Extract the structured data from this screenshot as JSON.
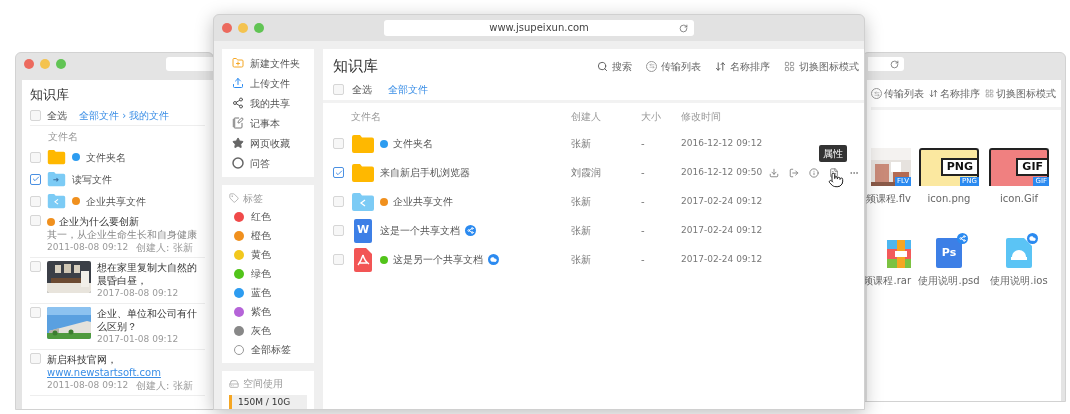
{
  "left_window": {
    "title": "知识库",
    "select_all": {
      "label": "全选",
      "checked": false
    },
    "breadcrumb": "全部文件 › 我的文件",
    "column_header": "文件名",
    "files": [
      {
        "kind": "folder",
        "name": "文件夹名",
        "color": "#2d9cf0",
        "checked": false
      },
      {
        "kind": "upload-folder",
        "name": "读写文件",
        "checked": true
      },
      {
        "kind": "share-folder",
        "name": "企业共享文件",
        "color": "#f0901e",
        "checked": false
      }
    ],
    "articles": [
      {
        "kind": "text",
        "title": "企业为什么要创新",
        "color": "#f0901e",
        "snippet": "其一，从企业生命生长和自身健康",
        "date": "2011-08-08 09:12",
        "creator": "创建人: 张新",
        "checked": false
      },
      {
        "kind": "room-picture",
        "title": "想在家里复制大自然的晨昏白昼，",
        "date": "2017-08-08 09:12",
        "checked": false
      },
      {
        "kind": "building-picture",
        "title": "企业、单位和公司有什么区别？",
        "date": "2017-01-08 09:12",
        "checked": false
      },
      {
        "kind": "link",
        "title": "新启科技官网，",
        "link": "www.newstartsoft.com",
        "date": "2011-08-08 09:12",
        "creator": "创建人: 张新",
        "checked": false
      }
    ]
  },
  "main_window": {
    "url": "www.jsupeixun.com",
    "menu": [
      {
        "kind": "new-folder",
        "label": "新建文件夹"
      },
      {
        "kind": "upload",
        "label": "上传文件"
      },
      {
        "kind": "share",
        "label": "我的共享"
      },
      {
        "kind": "notebook",
        "label": "记事本"
      },
      {
        "kind": "star",
        "label": "网页收藏"
      },
      {
        "kind": "qa",
        "label": "问答"
      }
    ],
    "tags_title": "标签",
    "tags": [
      {
        "kind": "color",
        "label": "红色",
        "color": "#f04a4a"
      },
      {
        "kind": "color",
        "label": "橙色",
        "color": "#f0901e"
      },
      {
        "kind": "color",
        "label": "黄色",
        "color": "#f2c81e"
      },
      {
        "kind": "color",
        "label": "绿色",
        "color": "#52c41a"
      },
      {
        "kind": "color",
        "label": "蓝色",
        "color": "#2d9cf0"
      },
      {
        "kind": "color",
        "label": "紫色",
        "color": "#b564d8"
      },
      {
        "kind": "color",
        "label": "灰色",
        "color": "#888888"
      },
      {
        "kind": "all",
        "label": "全部标签"
      }
    ],
    "storage": {
      "title": "空间使用",
      "reading": "150M / 10G",
      "level": 0.04
    },
    "title": "知识库",
    "toolbar": [
      {
        "kind": "search",
        "label": "搜索"
      },
      {
        "kind": "transfer",
        "label": "传输列表"
      },
      {
        "kind": "sort",
        "label": "名称排序"
      },
      {
        "kind": "view",
        "label": "切换图标模式"
      }
    ],
    "select_all": {
      "label": "全选",
      "checked": false
    },
    "breadcrumb": "全部文件",
    "columns": [
      "文件名",
      "创建人",
      "大小",
      "修改时间"
    ],
    "rows": [
      {
        "kind": "folder",
        "name": "文件夹名",
        "color": "#2d9cf0",
        "creator": "张新",
        "size": "-",
        "modified": "2016-12-12 09:12",
        "checked": false,
        "actions_visible": false
      },
      {
        "kind": "folder",
        "name": "来自新启手机浏览器",
        "creator": "刘霞润",
        "size": "-",
        "modified": "2016-12-12 09:50",
        "checked": true,
        "actions_visible": true,
        "tooltip": "属性"
      },
      {
        "kind": "share-folder",
        "name": "企业共享文件",
        "color": "#f0901e",
        "creator": "张新",
        "size": "-",
        "modified": "2017-02-24 09:12",
        "checked": false,
        "actions_visible": false
      },
      {
        "kind": "word",
        "icon_text": "W",
        "name": "这是一个共享文档",
        "badge": {
          "kind": "share"
        },
        "creator": "张新",
        "size": "-",
        "modified": "2017-02-24 09:12",
        "checked": false,
        "actions_visible": false
      },
      {
        "kind": "pdf",
        "name": "这是另一个共享文档",
        "color": "#52c41a",
        "badge": {
          "kind": "link"
        },
        "creator": "张新",
        "size": "-",
        "modified": "2017-02-24 09:12",
        "checked": false,
        "actions_visible": false
      }
    ]
  },
  "right_window": {
    "toolbar": [
      {
        "kind": "transfer",
        "label": "传输列表"
      },
      {
        "kind": "sort",
        "label": "名称排序"
      },
      {
        "kind": "view",
        "label": "切换图标模式"
      }
    ],
    "items": [
      {
        "kind": "video",
        "name": "频课程.flv",
        "tag": "FLV"
      },
      {
        "name": "icon.png",
        "label": "PNG",
        "tag": "PNG",
        "color": "#fbe8a0"
      },
      {
        "name": "icon.Gif",
        "label": "GIF",
        "tag": "GIF",
        "color": "#f08080"
      },
      {
        "kind": "archive",
        "name": "频课程.rar"
      },
      {
        "kind": "psd",
        "name": "使用说明.psd",
        "icon_text": "Ps",
        "badge": {
          "kind": "share"
        }
      },
      {
        "kind": "app",
        "name": "使用说明.ios",
        "badge": {
          "kind": "link"
        }
      }
    ]
  }
}
